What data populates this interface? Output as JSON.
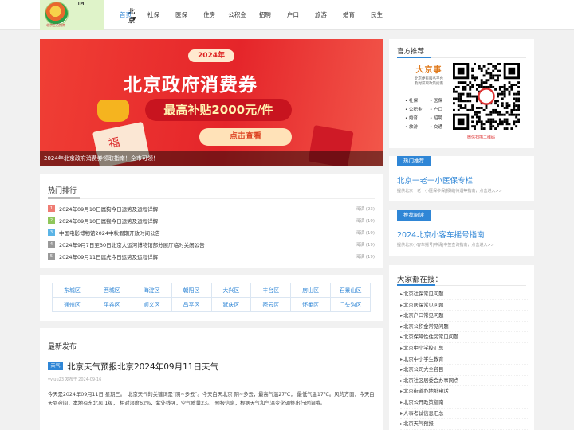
{
  "header": {
    "logo_tm": "TM",
    "logo_text": "北京生活指南",
    "city": "北京",
    "city_caret": "▼",
    "nav": [
      "首页",
      "社保",
      "医保",
      "住房",
      "公积金",
      "招聘",
      "户口",
      "旅游",
      "婚育",
      "民生"
    ],
    "active_index": 0
  },
  "banner": {
    "year": "2024年",
    "title": "北京政府消费券",
    "subtitle": "最高补贴2000元/件",
    "button": "点击查看",
    "envelope_char": "福",
    "caption": "2024年北京政府消费券领取指南！全市可领！"
  },
  "hot": {
    "title": "热门排行",
    "items": [
      {
        "num": "1",
        "title": "2024年09月10日属狗今日运势及运程详解",
        "reads": "阅读 (23)",
        "color": "#ef7c73"
      },
      {
        "num": "2",
        "title": "2024年09月10日属猴今日运势及运程详解",
        "reads": "阅读 (19)",
        "color": "#8fc65a"
      },
      {
        "num": "3",
        "title": "中国电影博物馆2024中秋假期开放时间公告",
        "reads": "阅读 (19)",
        "color": "#5bb4e6"
      },
      {
        "num": "4",
        "title": "2024年9月7日至30日北京大运河博物馆部分展厅临时关闭公告",
        "reads": "阅读 (19)",
        "color": "#999999"
      },
      {
        "num": "5",
        "title": "2024年09月11日属虎今日运势及运程详解",
        "reads": "阅读 (19)",
        "color": "#999999"
      }
    ]
  },
  "districts": [
    [
      "东城区",
      "西城区",
      "海淀区",
      "朝阳区",
      "大兴区",
      "丰台区",
      "房山区",
      "石景山区"
    ],
    [
      "通州区",
      "平谷区",
      "顺义区",
      "昌平区",
      "延庆区",
      "密云区",
      "怀柔区",
      "门头沟区"
    ]
  ],
  "news": {
    "title": "最新发布",
    "tag": "天气",
    "headline": "北京天气预报北京2024年09月11日天气",
    "meta": "yyjuu23 发布于 2024-09-16",
    "body": "今天是2024年09月11日 星期三。　北京天气的关键词是“阴~多云”。今天白天北京 阴~多云，最高气温27℃， 最低气温17℃。风的方面，今天白天到夜间，本地有东北风 1级， 相对湿度62%，紫外线强，空气质量23。　预报信息，根据天气和气温变化调整出行时间哦。"
  },
  "official": {
    "title": "官方推荐",
    "brand": "大京事",
    "desc": "北京便民服务平台\n及时获取政策指南",
    "features": [
      "• 社保",
      "• 医保",
      "• 公积金",
      "• 户口",
      "• 婚育",
      "• 招聘",
      "• 旅游",
      "• 交通"
    ],
    "qr_caption": "微信扫描二维码"
  },
  "cards": [
    {
      "tag": "热门推荐",
      "title": "北京一老一小医保专栏",
      "desc": "提供北京一老一小医保参保|报销|待遇等指南，点击进入>>"
    },
    {
      "tag": "推荐阅读",
      "title": "2024北京小客车摇号指南",
      "desc": "提供北京小客车摇号|申请|中签查询指南，点击进入>>"
    }
  ],
  "search": {
    "title": "大家都在搜：",
    "items": [
      "北京社保常见问题",
      "北京医保常见问题",
      "北京户口常见问题",
      "北京公积金常见问题",
      "北京保障性住房常见问题",
      "北京中小学校汇总",
      "北京中小学生教育",
      "北京公司大全名目",
      "北京社区居委会办事网点",
      "北京街道办地址电话",
      "北京公开政策指南",
      "人事考试信息汇总",
      "北京天气预报"
    ]
  }
}
